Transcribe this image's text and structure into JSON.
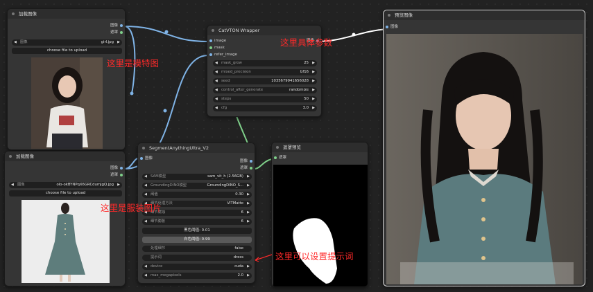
{
  "node_load_model": {
    "title": "加载图像",
    "out_image": "图像",
    "out_mask": "遮罩",
    "image_label": "图像",
    "image_value": "girl.jpg",
    "upload_label": "choose file to upload"
  },
  "node_load_cloth": {
    "title": "加载图像",
    "out_image": "图像",
    "out_mask": "遮罩",
    "image_label": "图像",
    "image_value": "olo-okBYNPqX6GRCdumJgQ.jpg",
    "upload_label": "choose file to upload"
  },
  "node_catvton": {
    "title": "CatVTON Wrapper",
    "in_image": "image",
    "in_mask": "mask",
    "in_refer": "refer_image",
    "out_image": "图像",
    "widgets": [
      {
        "label": "mask_grow",
        "value": "25"
      },
      {
        "label": "mixed_precision",
        "value": "bf16"
      },
      {
        "label": "seed",
        "value": "1035679941656028"
      },
      {
        "label": "control_after_generate",
        "value": "randomize"
      },
      {
        "label": "steps",
        "value": "50"
      },
      {
        "label": "cfg",
        "value": "3.0"
      }
    ]
  },
  "node_segment": {
    "title": "SegmentAnythingUltra_V2",
    "in_image": "图像",
    "out_image": "图像",
    "out_mask": "遮罩",
    "widgets": [
      {
        "label": "SAM模型",
        "value": "sam_vit_h (2.56GB)"
      },
      {
        "label": "GroundingDINO模型",
        "value": "GroundingDINO_S..."
      },
      {
        "label": "阈值",
        "value": "0.30"
      },
      {
        "label": "细节处理方法",
        "value": "VITMatte"
      },
      {
        "label": "细节腐蚀",
        "value": "6"
      },
      {
        "label": "细节膨胀",
        "value": "6"
      }
    ],
    "black_point": "黑色阈值: 0.01",
    "white_point": "白色阈值: 0.99",
    "widgets2": [
      {
        "label": "处理细节",
        "value": "false"
      },
      {
        "label": "提示词",
        "value": "dress"
      },
      {
        "label": "device",
        "value": "cuda"
      },
      {
        "label": "max_megapixels",
        "value": "2.0"
      }
    ]
  },
  "node_mask_preview": {
    "title": "遮罩预览",
    "in_mask": "遮罩"
  },
  "node_preview": {
    "title": "预览图像",
    "in_image": "图像"
  },
  "annotations": {
    "model_image": "这里是模特图",
    "params": "这里具体参数",
    "cloth_image": "这里是服装图片",
    "prompt": "这里可以设置提示词"
  },
  "colors": {
    "annotation": "#ff2a2a",
    "wire_image": "#7fb3e6",
    "wire_mask": "#7fd08a",
    "wire_white": "#ffffff",
    "node_bg": "#353535",
    "canvas_bg": "#222222"
  }
}
